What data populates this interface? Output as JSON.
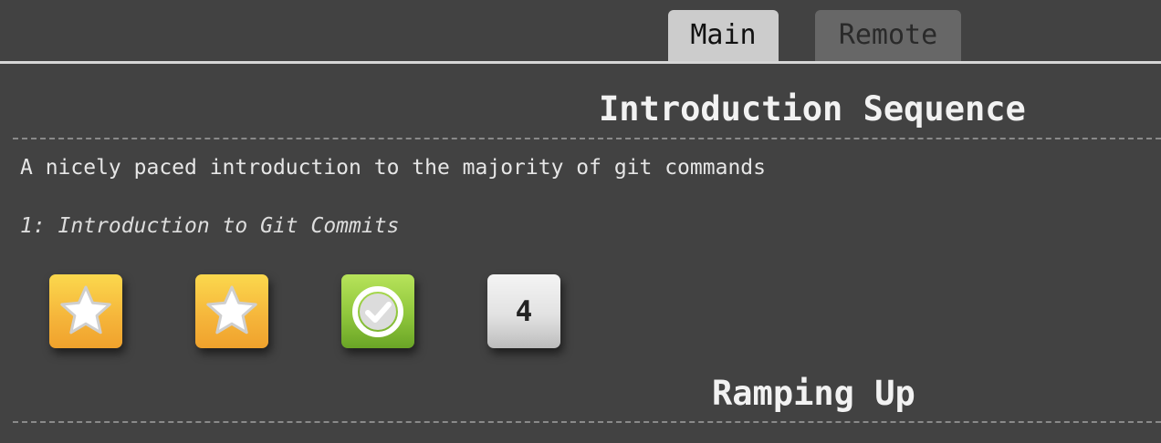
{
  "tabs": {
    "main_label": "Main",
    "remote_label": "Remote",
    "active": "Main"
  },
  "sections": [
    {
      "title": "Introduction Sequence",
      "description": "A nicely paced introduction to the majority of git commands",
      "level_caption": "1: Introduction to Git Commits",
      "levels": [
        {
          "status": "solved",
          "icon": "star-icon"
        },
        {
          "status": "solved",
          "icon": "star-icon"
        },
        {
          "status": "completed",
          "icon": "checkmark-icon"
        },
        {
          "status": "unsolved",
          "label": "4"
        }
      ]
    },
    {
      "title": "Ramping Up"
    }
  ],
  "colors": {
    "background": "#424242",
    "tab_active": "#cccccc",
    "tab_inactive": "#676767",
    "star_tile": "#f5b43a",
    "check_tile": "#8fc63c",
    "number_tile": "#e2e2e2"
  }
}
